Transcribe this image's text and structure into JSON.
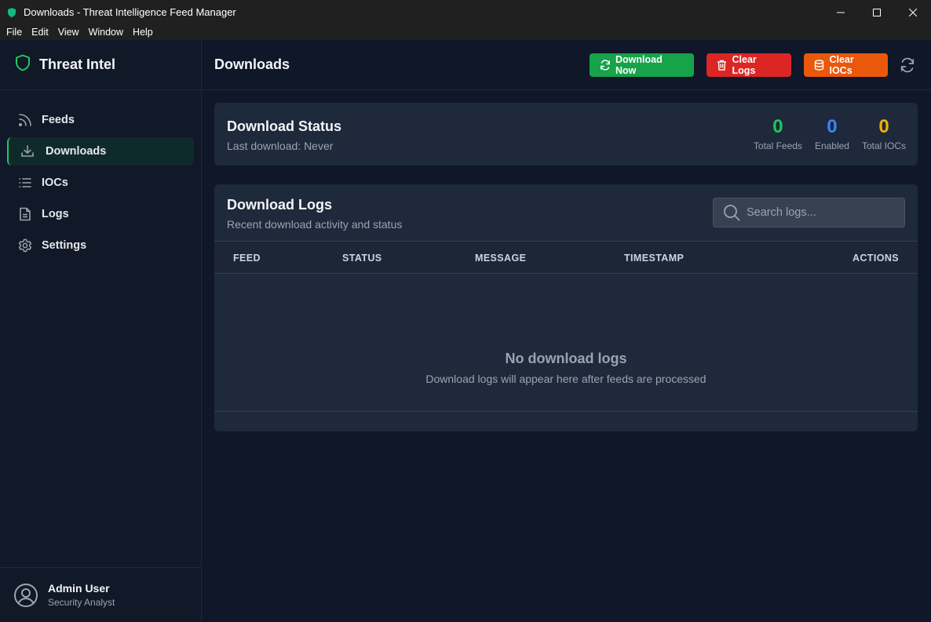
{
  "window": {
    "title": "Downloads - Threat Intelligence Feed Manager",
    "controls": [
      "minimize",
      "maximize",
      "close"
    ]
  },
  "menubar": {
    "items": [
      "File",
      "Edit",
      "View",
      "Window",
      "Help"
    ]
  },
  "sidebar": {
    "brand": "Threat Intel",
    "items": [
      {
        "label": "Feeds",
        "icon": "rss-icon"
      },
      {
        "label": "Downloads",
        "icon": "download-icon",
        "active": true
      },
      {
        "label": "IOCs",
        "icon": "list-icon"
      },
      {
        "label": "Logs",
        "icon": "file-text-icon"
      },
      {
        "label": "Settings",
        "icon": "gear-icon"
      }
    ],
    "user": {
      "name": "Admin User",
      "role": "Security Analyst"
    }
  },
  "header": {
    "title": "Downloads",
    "buttons": {
      "download_now": "Download Now",
      "clear_logs": "Clear Logs",
      "clear_iocs": "Clear IOCs"
    }
  },
  "status": {
    "title": "Download Status",
    "subtitle": "Last download: Never",
    "stats": [
      {
        "value": "0",
        "label": "Total Feeds",
        "color": "#22c55e"
      },
      {
        "value": "0",
        "label": "Enabled",
        "color": "#3b82f6"
      },
      {
        "value": "0",
        "label": "Total IOCs",
        "color": "#eab308"
      }
    ]
  },
  "logs": {
    "title": "Download Logs",
    "subtitle": "Recent download activity and status",
    "search_placeholder": "Search logs...",
    "columns": [
      "FEED",
      "STATUS",
      "MESSAGE",
      "TIMESTAMP",
      "ACTIONS"
    ],
    "empty_title": "No download logs",
    "empty_subtitle": "Download logs will appear here after feeds are processed"
  },
  "colors": {
    "accent": "#22c55e",
    "download": "#16a34a",
    "clear_logs": "#dc2626",
    "clear_iocs": "#ea580c"
  }
}
